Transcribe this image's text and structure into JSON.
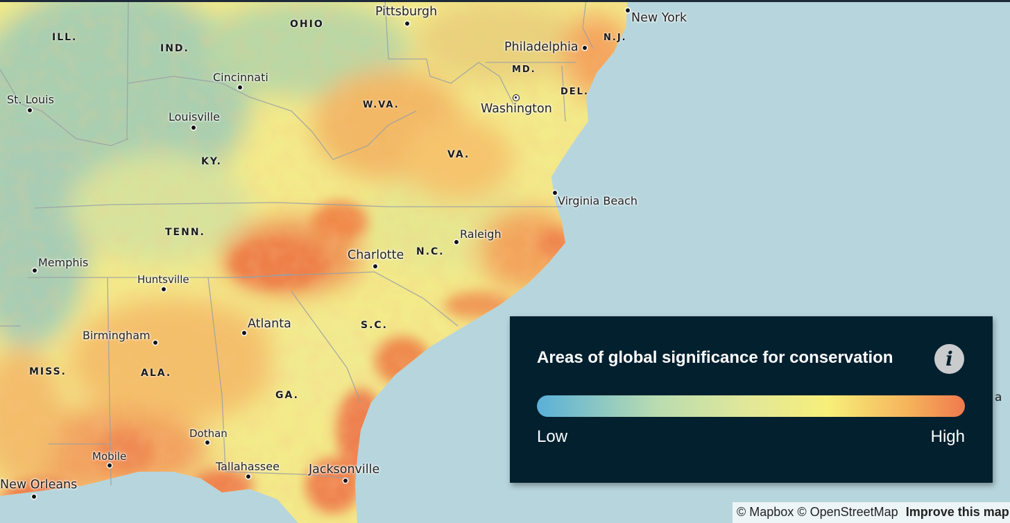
{
  "map": {
    "colors": {
      "water": "#b7d5dd",
      "land_low": "#9fc8b0",
      "land_mid": "#f3ea8a",
      "land_high": "#ee8450",
      "border": "#9aa0a6"
    },
    "state_labels": [
      "OHIO",
      "ILL.",
      "IND.",
      "N.J.",
      "MD.",
      "DEL.",
      "W.VA.",
      "KY.",
      "VA.",
      "TENN.",
      "N.C.",
      "S.C.",
      "MISS.",
      "ALA.",
      "GA."
    ],
    "cities": [
      {
        "name": "Pittsburgh"
      },
      {
        "name": "New York"
      },
      {
        "name": "Philadelphia"
      },
      {
        "name": "Cincinnati"
      },
      {
        "name": "St. Louis"
      },
      {
        "name": "Washington"
      },
      {
        "name": "Louisville"
      },
      {
        "name": "Virginia Beach"
      },
      {
        "name": "Raleigh"
      },
      {
        "name": "Charlotte"
      },
      {
        "name": "Memphis"
      },
      {
        "name": "Huntsville"
      },
      {
        "name": "Atlanta"
      },
      {
        "name": "Birmingham"
      },
      {
        "name": "Dothan"
      },
      {
        "name": "Mobile"
      },
      {
        "name": "Tallahassee"
      },
      {
        "name": "Jacksonville"
      },
      {
        "name": "New Orleans"
      }
    ],
    "edge_fragment": "a"
  },
  "legend": {
    "title": "Areas of global significance for conservation",
    "info_icon": "info-icon",
    "info_glyph": "i",
    "low_label": "Low",
    "high_label": "High",
    "gradient_colors": [
      "#5ab0d8",
      "#b9dcb0",
      "#dfe79a",
      "#f7ef7a",
      "#f6b65c",
      "#f07a4e"
    ]
  },
  "attribution": {
    "mapbox": "© Mapbox",
    "osm": "© OpenStreetMap",
    "improve": "Improve this map"
  }
}
